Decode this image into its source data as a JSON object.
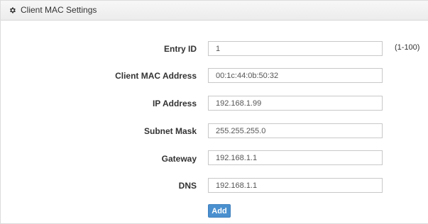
{
  "panel": {
    "title": "Client MAC Settings",
    "header_icon": "gear-icon"
  },
  "form": {
    "entry_id": {
      "label": "Entry ID",
      "value": "1",
      "hint": "(1-100)"
    },
    "client_mac": {
      "label": "Client MAC Address",
      "value": "00:1c:44:0b:50:32"
    },
    "ip_address": {
      "label": "IP Address",
      "value": "192.168.1.99"
    },
    "subnet_mask": {
      "label": "Subnet Mask",
      "value": "255.255.255.0"
    },
    "gateway": {
      "label": "Gateway",
      "value": "192.168.1.1"
    },
    "dns": {
      "label": "DNS",
      "value": "192.168.1.1"
    }
  },
  "actions": {
    "add_label": "Add"
  },
  "colors": {
    "button": "#4a90cf",
    "header_bg": "#eeeeee"
  }
}
